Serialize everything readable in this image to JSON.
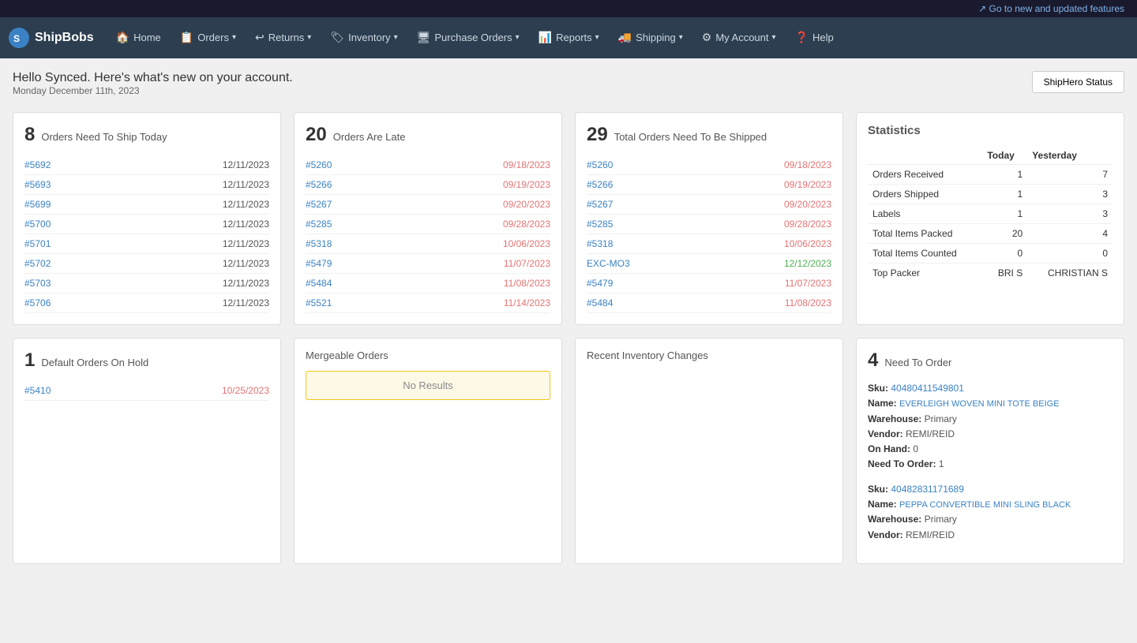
{
  "banner": {
    "text": "Go to new and updated features",
    "icon": "external-link-icon"
  },
  "nav": {
    "logo": "ShipBobs",
    "items": [
      {
        "id": "home",
        "label": "Home",
        "icon": "🏠",
        "hasDropdown": false
      },
      {
        "id": "orders",
        "label": "Orders",
        "icon": "📋",
        "hasDropdown": true
      },
      {
        "id": "returns",
        "label": "Returns",
        "icon": "↩",
        "hasDropdown": true
      },
      {
        "id": "inventory",
        "label": "Inventory",
        "icon": "🏷",
        "hasDropdown": true
      },
      {
        "id": "purchase-orders",
        "label": "Purchase Orders",
        "icon": "🖥",
        "hasDropdown": true
      },
      {
        "id": "reports",
        "label": "Reports",
        "icon": "📊",
        "hasDropdown": true
      },
      {
        "id": "shipping",
        "label": "Shipping",
        "icon": "🚚",
        "hasDropdown": true
      },
      {
        "id": "my-account",
        "label": "My Account",
        "icon": "⚙",
        "hasDropdown": true
      },
      {
        "id": "help",
        "label": "Help",
        "icon": "❓",
        "hasDropdown": false
      }
    ]
  },
  "greeting": {
    "title": "Hello Synced. Here's what's new on your account.",
    "date": "Monday December 11th, 2023",
    "status_button": "ShipHero Status"
  },
  "cards": {
    "orders_today": {
      "number": "8",
      "title": "Orders Need To Ship Today",
      "items": [
        {
          "id": "#5692",
          "date": "12/11/2023",
          "late": false
        },
        {
          "id": "#5693",
          "date": "12/11/2023",
          "late": false
        },
        {
          "id": "#5699",
          "date": "12/11/2023",
          "late": false
        },
        {
          "id": "#5700",
          "date": "12/11/2023",
          "late": false
        },
        {
          "id": "#5701",
          "date": "12/11/2023",
          "late": false
        },
        {
          "id": "#5702",
          "date": "12/11/2023",
          "late": false
        },
        {
          "id": "#5703",
          "date": "12/11/2023",
          "late": false
        },
        {
          "id": "#5706",
          "date": "12/11/2023",
          "late": false
        }
      ]
    },
    "orders_late": {
      "number": "20",
      "title": "Orders Are Late",
      "items": [
        {
          "id": "#5260",
          "date": "09/18/2023",
          "late": true
        },
        {
          "id": "#5266",
          "date": "09/19/2023",
          "late": true
        },
        {
          "id": "#5267",
          "date": "09/20/2023",
          "late": true
        },
        {
          "id": "#5285",
          "date": "09/28/2023",
          "late": true
        },
        {
          "id": "#5318",
          "date": "10/06/2023",
          "late": true
        },
        {
          "id": "#5479",
          "date": "11/07/2023",
          "late": true
        },
        {
          "id": "#5484",
          "date": "11/08/2023",
          "late": true
        },
        {
          "id": "#5521",
          "date": "11/14/2023",
          "late": true
        }
      ]
    },
    "orders_total": {
      "number": "29",
      "title": "Total Orders Need To Be Shipped",
      "items": [
        {
          "id": "#5260",
          "date": "09/18/2023",
          "late": true
        },
        {
          "id": "#5266",
          "date": "09/19/2023",
          "late": true
        },
        {
          "id": "#5267",
          "date": "09/20/2023",
          "late": true
        },
        {
          "id": "#5285",
          "date": "09/28/2023",
          "late": true
        },
        {
          "id": "#5318",
          "date": "10/06/2023",
          "late": true
        },
        {
          "id": "EXC-MO3",
          "date": "12/12/2023",
          "late": false,
          "green": true
        },
        {
          "id": "#5479",
          "date": "11/07/2023",
          "late": true
        },
        {
          "id": "#5484",
          "date": "11/08/2023",
          "late": true
        }
      ]
    },
    "statistics": {
      "title": "Statistics",
      "columns": [
        "",
        "Today",
        "Yesterday"
      ],
      "rows": [
        {
          "label": "Orders Received",
          "today": "1",
          "yesterday": "7"
        },
        {
          "label": "Orders Shipped",
          "today": "1",
          "yesterday": "3"
        },
        {
          "label": "Labels",
          "today": "1",
          "yesterday": "3"
        },
        {
          "label": "Total Items Packed",
          "today": "20",
          "yesterday": "4"
        },
        {
          "label": "Total Items Counted",
          "today": "0",
          "yesterday": "0"
        },
        {
          "label": "Top Packer",
          "today": "BRI S",
          "yesterday": "CHRISTIAN S"
        }
      ]
    },
    "orders_on_hold": {
      "number": "1",
      "title": "Default Orders On Hold",
      "items": [
        {
          "id": "#5410",
          "date": "10/25/2023",
          "late": true
        }
      ]
    },
    "mergeable": {
      "title": "Mergeable Orders",
      "no_results": "No Results"
    },
    "recent_inventory": {
      "title": "Recent Inventory Changes"
    },
    "need_to_order": {
      "number": "4",
      "title": "Need To Order",
      "items": [
        {
          "sku": "40480411549801",
          "name": "EVERLEIGH WOVEN MINI TOTE BEIGE",
          "warehouse": "Primary",
          "vendor": "REMI/REID",
          "on_hand": "0",
          "need_to_order": "1"
        },
        {
          "sku": "40482831171689",
          "name": "PEPPA CONVERTIBLE MINI SLING BLACK",
          "warehouse": "Primary",
          "vendor": "REMI/REID",
          "on_hand": "",
          "need_to_order": ""
        }
      ]
    }
  }
}
